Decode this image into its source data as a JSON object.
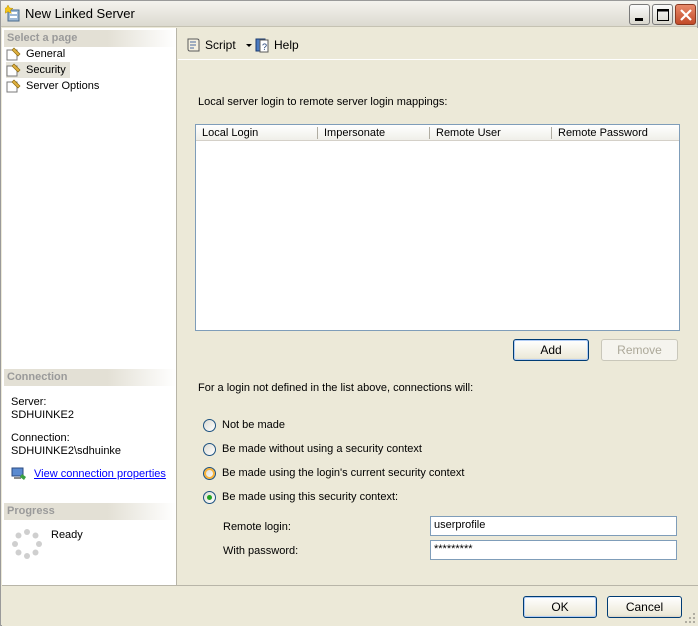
{
  "window": {
    "title": "New Linked Server"
  },
  "left": {
    "select_page_header": "Select a page",
    "pages": [
      {
        "label": "General",
        "icon": "page-wrench-icon"
      },
      {
        "label": "Security",
        "icon": "page-wrench-icon"
      },
      {
        "label": "Server Options",
        "icon": "page-wrench-icon"
      }
    ],
    "connection_header": "Connection",
    "server_label": "Server:",
    "server_value": "SDHUINKE2",
    "connection_label": "Connection:",
    "connection_value": "SDHUINKE2\\sdhuinke",
    "view_props": "View connection properties",
    "progress_header": "Progress",
    "progress_status": "Ready"
  },
  "toolbar": {
    "script_label": "Script",
    "help_label": "Help"
  },
  "security": {
    "mappings_label": "Local server login to remote server login mappings:",
    "columns": [
      "Local Login",
      "Impersonate",
      "Remote User",
      "Remote Password"
    ],
    "add_label": "Add",
    "remove_label": "Remove",
    "not_defined_label": "For a login not defined in the list above, connections will:",
    "options": [
      "Not be made",
      "Be made without using a security context",
      "Be made using the login's current security context",
      "Be made using this security context:"
    ],
    "selected_option": 3,
    "remote_login_label": "Remote login:",
    "remote_login_value": "userprofile",
    "password_label": "With password:",
    "password_value": "*********"
  },
  "footer": {
    "ok_label": "OK",
    "cancel_label": "Cancel"
  }
}
